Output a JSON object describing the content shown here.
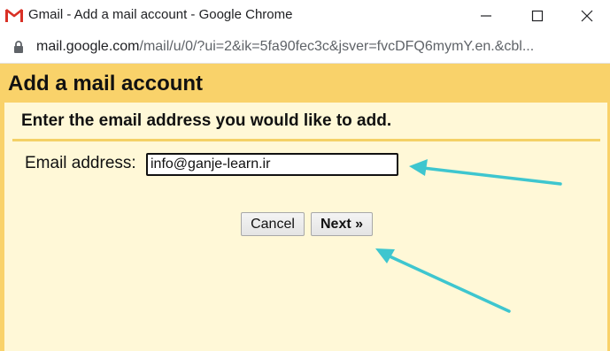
{
  "window": {
    "title": "Gmail - Add a mail account - Google Chrome",
    "icons": {
      "app": "gmail-logo-icon",
      "minimize": "minimize-icon",
      "maximize": "maximize-icon",
      "close": "close-icon"
    }
  },
  "addressbar": {
    "icon": "lock-icon",
    "url_host": "mail.google.com",
    "url_path": "/mail/u/0/?ui=2&ik=5fa90fec3c&jsver=fvcDFQ6mymY.en.&cbl..."
  },
  "page": {
    "title": "Add a mail account",
    "subheading": "Enter the email address you would like to add.",
    "email_label": "Email address:",
    "email_value": "info@ganje-learn.ir",
    "cancel_label": "Cancel",
    "next_label": "Next »"
  },
  "colors": {
    "header": "#f9d26a",
    "page_background": "#fff8d7",
    "annotation_arrow": "#3ec6cf"
  }
}
